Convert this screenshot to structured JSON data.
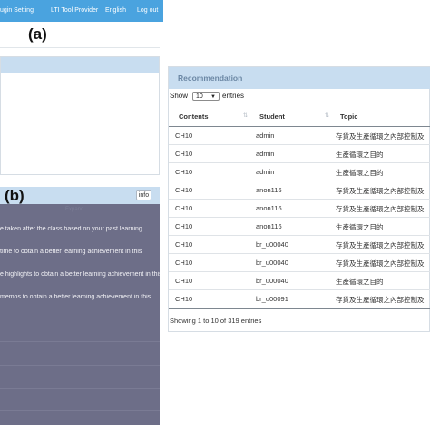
{
  "nav": {
    "items": [
      "ugin Setting",
      "LTI Tool Provider",
      "English",
      "Log out"
    ]
  },
  "labels": {
    "a": "(a)",
    "b": "(b)"
  },
  "panel_b": {
    "info_label": "info",
    "header_faint": "Expand",
    "lines": [
      "e taken after the class based on your past learning",
      "time to obtain a better learning achievement in this",
      "e highlights to obtain a better learning achievement in this",
      "memos to obtain a better learning achievement in this"
    ]
  },
  "recommendation": {
    "title": "Recommendation",
    "show_label": "Show",
    "page_size": "10",
    "entries_label": "entries",
    "columns": [
      "Contents",
      "Student",
      "Topic"
    ],
    "rows": [
      [
        "CH10",
        "admin",
        "存貨及生產循環之內部控制及"
      ],
      [
        "CH10",
        "admin",
        "生產循環之目的"
      ],
      [
        "CH10",
        "admin",
        "生產循環之目的"
      ],
      [
        "CH10",
        "anon116",
        "存貨及生產循環之內部控制及"
      ],
      [
        "CH10",
        "anon116",
        "存貨及生產循環之內部控制及"
      ],
      [
        "CH10",
        "anon116",
        "生產循環之目的"
      ],
      [
        "CH10",
        "br_u00040",
        "存貨及生產循環之內部控制及"
      ],
      [
        "CH10",
        "br_u00040",
        "存貨及生產循環之內部控制及"
      ],
      [
        "CH10",
        "br_u00040",
        "生產循環之目的"
      ],
      [
        "CH10",
        "br_u00091",
        "存貨及生產循環之內部控制及"
      ]
    ],
    "footer": "Showing 1 to 10 of 319 entries"
  },
  "colors": {
    "nav_bar": "#4aa3df",
    "panel_header": "#c8ddf0",
    "panel_b_body": "#6d6e88",
    "title_text": "#6a86a3"
  }
}
